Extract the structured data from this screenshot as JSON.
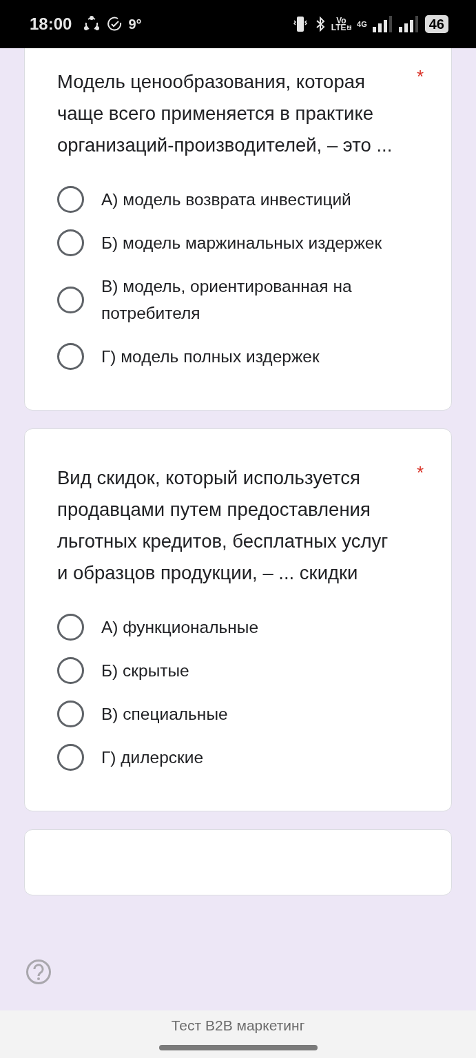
{
  "status_bar": {
    "time": "18:00",
    "temperature": "9°",
    "volte_top": "Vo",
    "volte_bottom": "LTE",
    "sim_slot": "2",
    "data_type": "4G",
    "battery": "46"
  },
  "questions": [
    {
      "text": "Модель ценообразования, которая чаще всего применяется в практике организаций-производителей, – это ...",
      "required_mark": "*",
      "options": [
        {
          "label": "А) модель возврата инвестиций",
          "selected": false
        },
        {
          "label": "Б) модель маржинальных издержек",
          "selected": false
        },
        {
          "label": "В) модель, ориентированная на потребителя",
          "selected": false
        },
        {
          "label": "Г) модель полных издержек",
          "selected": false
        }
      ]
    },
    {
      "text": "Вид скидок, который используется продавцами путем предоставления льготных кредитов, бесплатных услуг и образцов продукции, – ... скидки",
      "required_mark": "*",
      "options": [
        {
          "label": "А) функциональные",
          "selected": false
        },
        {
          "label": "Б) скрытые",
          "selected": false
        },
        {
          "label": "В) специальные",
          "selected": false
        },
        {
          "label": "Г) дилерские",
          "selected": false
        }
      ]
    }
  ],
  "footer": {
    "title": "Тест B2B маркетинг"
  }
}
